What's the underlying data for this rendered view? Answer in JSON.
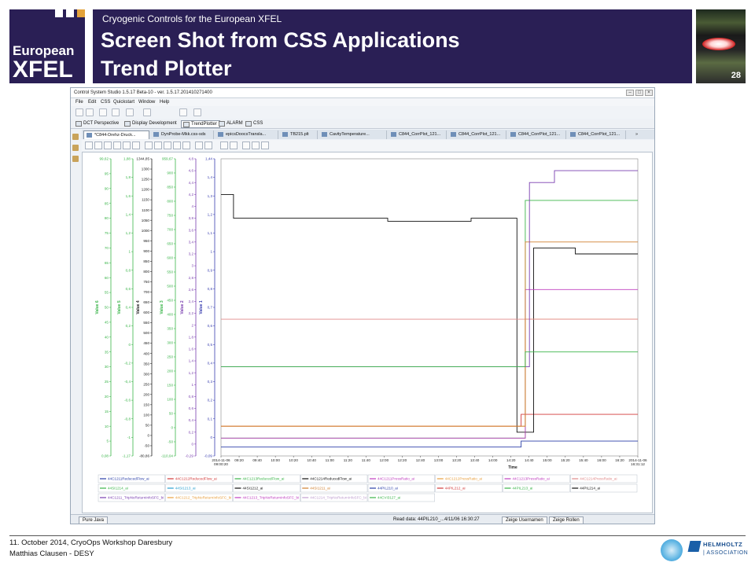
{
  "slide": {
    "logo_line1": "European",
    "logo_line2": "XFEL",
    "subtitle": "Cryogenic Controls for the European XFEL",
    "title_line1": "Screen Shot from CSS Applications",
    "title_line2": "Trend Plotter",
    "page_number": "28",
    "footer_line1": "11. October 2014, CryoOps Workshop Daresbury",
    "footer_line2": "Matthias Clausen - DESY",
    "helmholtz_line1": "HELMHOLTZ",
    "helmholtz_line2": "| ASSOCIATION",
    "colors": {
      "header_bg": "#2a1f55",
      "logo_squares": [
        "#ffffff",
        "#ffffff",
        "#ffffff",
        "#e3a23a"
      ]
    }
  },
  "app": {
    "window_title": "Control System Studio 1.5.17 Beta-10 - ver. 1.5.17.201410271400",
    "window_controls": [
      "–",
      "□",
      "×"
    ],
    "menu": [
      "File",
      "Edit",
      "CSS",
      "Quickstart",
      "Window",
      "Help"
    ],
    "perspectives": [
      "DCT Perspective",
      "Display Development",
      "TrendPlotter",
      "ALARM",
      "CSS"
    ],
    "active_perspective": "TrendPlotter",
    "editor_tabs": [
      "*C844-Drehz-Druck...",
      "DynProbe-Mkk.css-sds",
      "epicsDoocsTransla...",
      "TB215.plt",
      "CavityTemperature...",
      "C844_CorrPlot_121...",
      "C844_CorrPlot_121...",
      "C844_CorrPlot_121...",
      "C844_CorrPlot_121..."
    ],
    "tab_overflow": "»",
    "status_bar": {
      "pure_java": "Pure Java",
      "read_data": "Read data: 44PIL210_...4/11/06 16:30:27",
      "button_left": "Zeige Usernamen",
      "button_right": "Zeige Rollen"
    }
  },
  "chart_data": {
    "type": "line",
    "xlabel": "Time",
    "x_ticks": [
      "2014-11-06\n09:00:20",
      "09:20",
      "09:40",
      "10:00",
      "10:20",
      "10:40",
      "11:00",
      "11:20",
      "11:40",
      "12:00",
      "12:20",
      "12:40",
      "13:00",
      "13:20",
      "13:40",
      "14:00",
      "14:20",
      "14:40",
      "15:00",
      "15:20",
      "15:40",
      "16:00",
      "16:20",
      "2014-11-06\n16:31:12"
    ],
    "axes": [
      {
        "label": "Value 6",
        "color": "#3bb54a",
        "ticks": [
          "99,62",
          "95",
          "90",
          "85",
          "80",
          "75",
          "70",
          "65",
          "60",
          "55",
          "50",
          "45",
          "40",
          "35",
          "30",
          "25",
          "20",
          "15",
          "10",
          "5",
          "0,08"
        ]
      },
      {
        "label": "Value 5",
        "color": "#3bb54a",
        "ticks": [
          "1,88",
          "1,8",
          "1,6",
          "1,4",
          "1,2",
          "1",
          "0,8",
          "0,6",
          "0,4",
          "0,2",
          "0",
          "-0,2",
          "-0,4",
          "-0,6",
          "-0,8",
          "-1",
          "-1,17"
        ]
      },
      {
        "label": "Value 4",
        "color": "#222222",
        "ticks": [
          "1344,85",
          "1300",
          "1250",
          "1200",
          "1150",
          "1100",
          "1050",
          "1000",
          "950",
          "900",
          "850",
          "800",
          "750",
          "700",
          "650",
          "600",
          "550",
          "500",
          "450",
          "400",
          "350",
          "300",
          "250",
          "200",
          "150",
          "100",
          "50",
          "0",
          "-50",
          "-80,86"
        ]
      },
      {
        "label": "Value 3",
        "color": "#3bb54a",
        "ticks": [
          "959,67",
          "900",
          "850",
          "800",
          "750",
          "700",
          "650",
          "600",
          "550",
          "500",
          "450",
          "400",
          "350",
          "300",
          "250",
          "200",
          "150",
          "100",
          "50",
          "0",
          "-50",
          "-110,04"
        ]
      },
      {
        "label": "Value 2",
        "color": "#7a3fb0",
        "ticks": [
          "4,8",
          "4,6",
          "4,4",
          "4,2",
          "4",
          "3,8",
          "3,6",
          "3,4",
          "3,2",
          "3",
          "2,8",
          "2,6",
          "2,4",
          "2,2",
          "2",
          "1,8",
          "1,6",
          "1,4",
          "1,2",
          "1",
          "0,8",
          "0,6",
          "0,4",
          "0,2",
          "0",
          "-0,29"
        ]
      },
      {
        "label": "Value 1",
        "color": "#3a3fb0",
        "ticks": [
          "1,44",
          "1,4",
          "1,3",
          "1,2",
          "1,1",
          "1",
          "0,9",
          "0,8",
          "0,7",
          "0,6",
          "0,5",
          "0,4",
          "0,3",
          "0,2",
          "0,1",
          "0",
          "-0,09"
        ]
      }
    ],
    "legend_rows": [
      [
        "44C1211ReducedFlow_ai",
        "44C1212ReducedFlow_ai",
        "44C1213ReducedFlow_ai",
        "44C1214ReducedFlow_ai",
        "44C1211PressRatio_ai",
        "44C1212PressRatio_ai",
        "44C1213PressRatio_ai",
        "44C1214PressRatio_ai"
      ],
      [
        "44SI1214_ai",
        "44SI1213_ai",
        "44SI1212_ai",
        "44SI1211_ai",
        "44PIL210_ai",
        "44PIL212_ai",
        "44PIL213_ai",
        "44PIL214_ai"
      ],
      [
        "44C1211_TripNoReturnInfoSFC_bi",
        "44C1212_TripNoReturnInfoSFC_bi",
        "44C1213_TripNoReturnInfoSFC_bi",
        "44C1214_TripNoReturnInfoSFC_bi",
        "44CVI3127_ai"
      ]
    ],
    "legend_colors": [
      [
        "#2b3fa8",
        "#d23a3a",
        "#3bb54a",
        "#111111",
        "#c040c0",
        "#e8a040",
        "#c040c0",
        "#e08a8a"
      ],
      [
        "#3bb54a",
        "#2aa0d0",
        "#111111",
        "#d08030",
        "#2b3fa8",
        "#d23a3a",
        "#3bb54a",
        "#111111"
      ],
      [
        "#7a3fb0",
        "#e8a040",
        "#c040c0",
        "#c0a0d0",
        "#3bb54a"
      ]
    ],
    "series": [
      {
        "name": "44C1211ReducedFlow_ai",
        "color": "#2b3fa8",
        "x": [
          0,
          0.71,
          0.72,
          1
        ],
        "y": [
          0.03,
          0.03,
          0.05,
          0.05
        ]
      },
      {
        "name": "44C1212ReducedFlow_ai",
        "color": "#d23a3a",
        "x": [
          0,
          0.71,
          0.72,
          1
        ],
        "y": [
          0.1,
          0.1,
          0.14,
          0.14
        ]
      },
      {
        "name": "44C1213ReducedFlow_ai",
        "color": "#3bb54a",
        "x": [
          0,
          0.7,
          0.73,
          1
        ],
        "y": [
          0.06,
          0.06,
          0.86,
          0.86
        ]
      },
      {
        "name": "44C1214ReducedFlow_ai",
        "color": "#111111",
        "x": [
          0,
          0.03,
          0.06,
          0.2,
          0.4,
          0.6,
          0.69,
          0.71,
          0.75,
          0.85,
          1
        ],
        "y": [
          0.88,
          0.8,
          0.8,
          0.8,
          0.79,
          0.8,
          0.8,
          0.08,
          0.7,
          0.68,
          0.68
        ]
      },
      {
        "name": "44C1211PressRatio_ai",
        "color": "#c040c0",
        "x": [
          0,
          0.71,
          0.73,
          1
        ],
        "y": [
          0.06,
          0.06,
          0.56,
          0.56
        ]
      },
      {
        "name": "44C1212PressRatio_ai",
        "color": "#e8a040",
        "x": [
          0,
          0.71,
          0.73,
          1
        ],
        "y": [
          0.1,
          0.1,
          0.46,
          0.46
        ]
      },
      {
        "name": "44C1214PressRatio_ai",
        "color": "#e08a8a",
        "x": [
          0,
          1
        ],
        "y": [
          0.46,
          0.46
        ]
      },
      {
        "name": "44PIL212_ai",
        "color": "#d08030",
        "x": [
          0,
          0.71,
          0.73,
          1
        ],
        "y": [
          0.1,
          0.1,
          0.72,
          0.72
        ]
      },
      {
        "name": "44C1211_TripNoReturnInfoSFC_bi",
        "color": "#7a3fb0",
        "x": [
          0,
          0.71,
          0.74,
          0.8,
          0.9,
          1
        ],
        "y": [
          0.3,
          0.3,
          0.92,
          0.96,
          0.96,
          0.96
        ]
      },
      {
        "name": "44CVI3127_ai",
        "color": "#3bb54a",
        "x": [
          0,
          0.71,
          0.73,
          1
        ],
        "y": [
          0.3,
          0.3,
          0.35,
          0.35
        ]
      }
    ]
  }
}
